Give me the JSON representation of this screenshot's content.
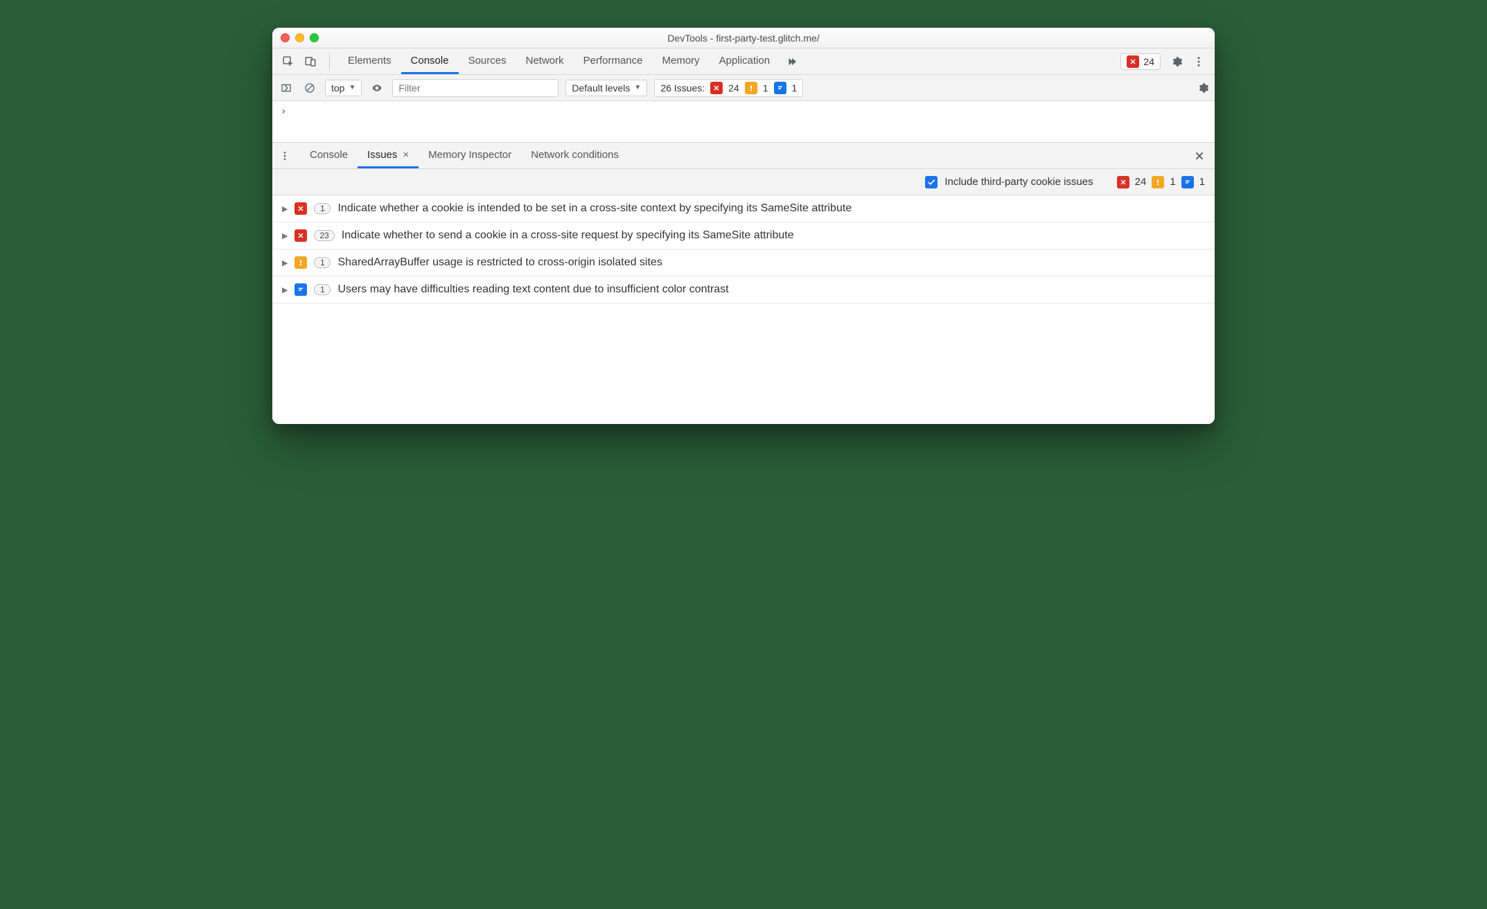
{
  "window": {
    "title": "DevTools - first-party-test.glitch.me/"
  },
  "toolbar": {
    "tabs": [
      "Elements",
      "Console",
      "Sources",
      "Network",
      "Performance",
      "Memory",
      "Application"
    ],
    "active": "Console",
    "error_chip_count": "24"
  },
  "consolebar": {
    "context": "top",
    "filter_placeholder": "Filter",
    "levels": "Default levels",
    "issues_label": "26 Issues:",
    "errors": "24",
    "warnings": "1",
    "info": "1"
  },
  "drawer": {
    "tabs": [
      "Console",
      "Issues",
      "Memory Inspector",
      "Network conditions"
    ],
    "active": "Issues"
  },
  "issues_toolbar": {
    "checkbox_label": "Include third-party cookie issues",
    "errors": "24",
    "warnings": "1",
    "info": "1"
  },
  "issues": [
    {
      "kind": "err",
      "count": "1",
      "title": "Indicate whether a cookie is intended to be set in a cross-site context by specifying its SameSite attribute"
    },
    {
      "kind": "err",
      "count": "23",
      "title": "Indicate whether to send a cookie in a cross-site request by specifying its SameSite attribute"
    },
    {
      "kind": "warn",
      "count": "1",
      "title": "SharedArrayBuffer usage is restricted to cross-origin isolated sites"
    },
    {
      "kind": "info",
      "count": "1",
      "title": "Users may have difficulties reading text content due to insufficient color contrast"
    }
  ]
}
